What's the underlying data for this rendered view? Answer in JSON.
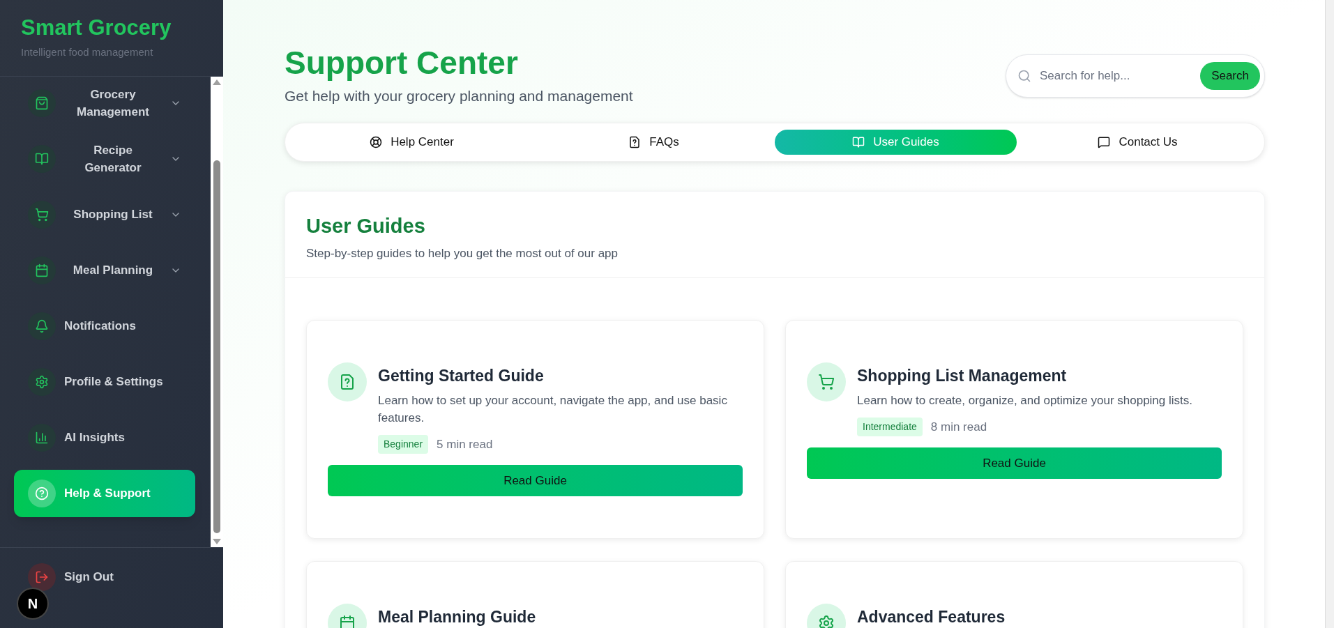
{
  "brand": {
    "title": "Smart Grocery",
    "subtitle": "Intelligent food management"
  },
  "nav": [
    {
      "label": "Grocery Management",
      "expanded": false,
      "selected": false
    },
    {
      "label": "Recipe Generator",
      "expanded": false,
      "selected": false
    },
    {
      "label": "Shopping List",
      "expanded": false,
      "selected": false
    },
    {
      "label": "Meal Planning",
      "expanded": false,
      "selected": false
    },
    {
      "label": "Notifications",
      "selected": false
    },
    {
      "label": "Profile & Settings",
      "selected": false
    },
    {
      "label": "AI Insights",
      "selected": false
    },
    {
      "label": "Help & Support",
      "selected": true
    }
  ],
  "sign_out": "Sign Out",
  "dev_badge": "N",
  "header": {
    "title": "Support Center",
    "subtitle": "Get help with your grocery planning and management"
  },
  "search": {
    "placeholder": "Search for help...",
    "button": "Search"
  },
  "tabs": [
    {
      "label": "Help Center",
      "selected": false
    },
    {
      "label": "FAQs",
      "selected": false
    },
    {
      "label": "User Guides",
      "selected": true
    },
    {
      "label": "Contact Us",
      "selected": false
    }
  ],
  "section": {
    "title": "User Guides",
    "subtitle": "Step-by-step guides to help you get the most out of our app"
  },
  "guides": [
    {
      "title": "Getting Started Guide",
      "description": "Learn how to set up your account, navigate the app, and use basic features.",
      "level": "Beginner",
      "read_time": "5 min read",
      "button": "Read Guide"
    },
    {
      "title": "Shopping List Management",
      "description": "Learn how to create, organize, and optimize your shopping lists.",
      "level": "Intermediate",
      "read_time": "8 min read",
      "button": "Read Guide"
    },
    {
      "title": "Meal Planning Guide"
    },
    {
      "title": "Advanced Features"
    }
  ]
}
